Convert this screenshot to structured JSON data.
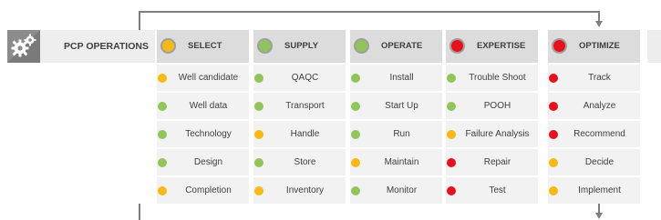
{
  "title": "PCP OPERATIONS",
  "title_icon": "gears-icon",
  "status_colors": {
    "green": "#92c559",
    "amber": "#f8b912",
    "red": "#e8101a"
  },
  "columns": [
    {
      "header": "SELECT",
      "status": "amber",
      "items": [
        {
          "label": "Well candidate",
          "status": "amber"
        },
        {
          "label": "Well data",
          "status": "green"
        },
        {
          "label": "Technology",
          "status": "green"
        },
        {
          "label": "Design",
          "status": "green"
        },
        {
          "label": "Completion",
          "status": "amber"
        }
      ]
    },
    {
      "header": "SUPPLY",
      "status": "green",
      "items": [
        {
          "label": "QAQC",
          "status": "green"
        },
        {
          "label": "Transport",
          "status": "green"
        },
        {
          "label": "Handle",
          "status": "amber"
        },
        {
          "label": "Store",
          "status": "green"
        },
        {
          "label": "Inventory",
          "status": "amber"
        }
      ]
    },
    {
      "header": "OPERATE",
      "status": "green",
      "items": [
        {
          "label": "Install",
          "status": "green"
        },
        {
          "label": "Start Up",
          "status": "green"
        },
        {
          "label": "Run",
          "status": "green"
        },
        {
          "label": "Maintain",
          "status": "amber"
        },
        {
          "label": "Monitor",
          "status": "green"
        }
      ]
    },
    {
      "header": "EXPERTISE",
      "status": "red",
      "items": [
        {
          "label": "Trouble Shoot",
          "status": "green"
        },
        {
          "label": "POOH",
          "status": "green"
        },
        {
          "label": "Failure Analysis",
          "status": "amber"
        },
        {
          "label": "Repair",
          "status": "red"
        },
        {
          "label": "Test",
          "status": "red"
        }
      ]
    },
    {
      "header": "OPTIMIZE",
      "status": "red",
      "items": [
        {
          "label": "Track",
          "status": "red"
        },
        {
          "label": "Analyze",
          "status": "red"
        },
        {
          "label": "Recommend",
          "status": "red"
        },
        {
          "label": "Decide",
          "status": "amber"
        },
        {
          "label": "Implement",
          "status": "amber"
        }
      ]
    }
  ]
}
